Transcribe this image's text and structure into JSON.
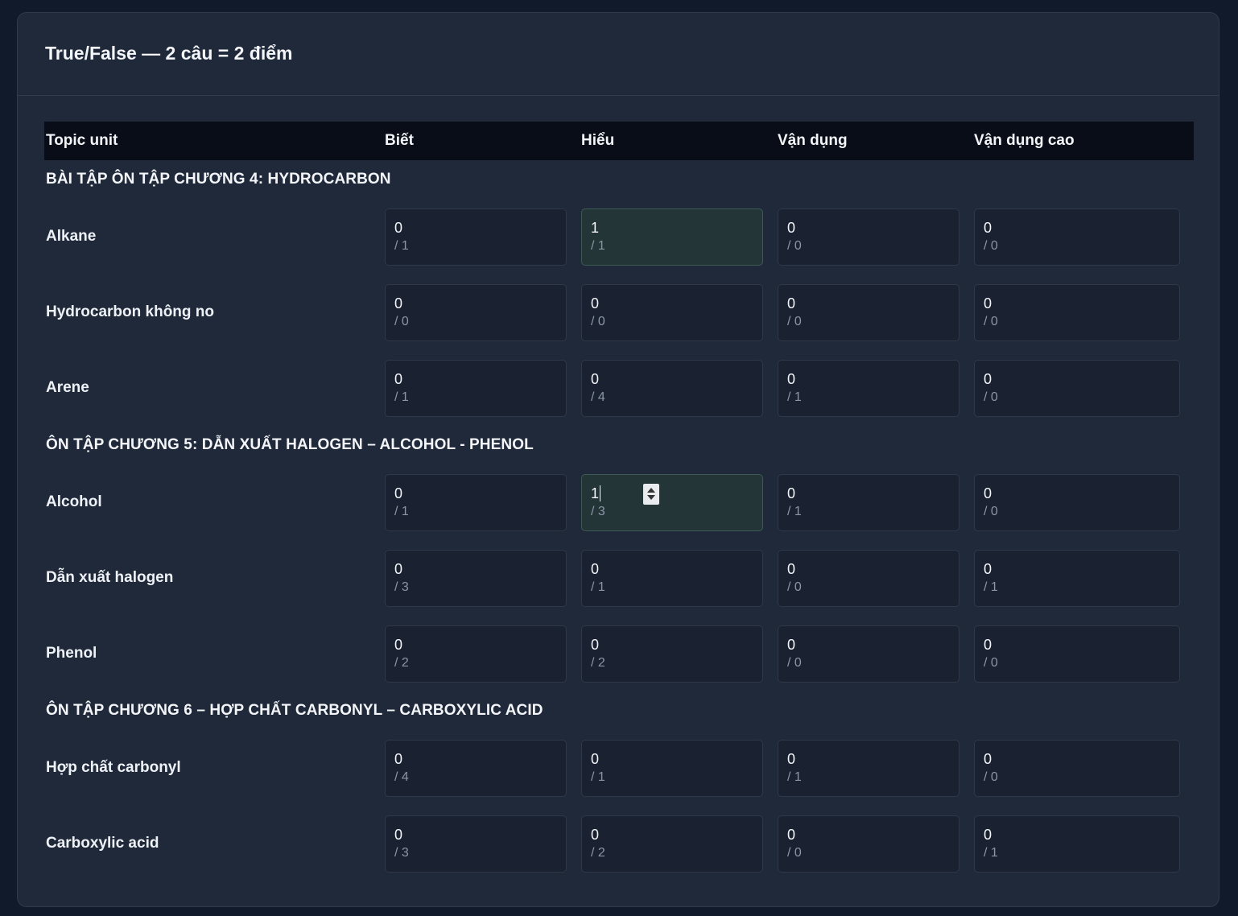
{
  "card": {
    "title": "True/False — 2 câu = 2 điểm"
  },
  "table": {
    "headers": [
      "Topic unit",
      "Biết",
      "Hiểu",
      "Vận dụng",
      "Vận dụng cao"
    ],
    "sections": [
      {
        "title": "BÀI TẬP ÔN TẬP CHƯƠNG 4: HYDROCARBON",
        "rows": [
          {
            "label": "Alkane",
            "cells": [
              {
                "value": "0",
                "max": "/ 1"
              },
              {
                "value": "1",
                "max": "/ 1",
                "active": true
              },
              {
                "value": "0",
                "max": "/ 0"
              },
              {
                "value": "0",
                "max": "/ 0"
              }
            ]
          },
          {
            "label": "Hydrocarbon không no",
            "cells": [
              {
                "value": "0",
                "max": "/ 0"
              },
              {
                "value": "0",
                "max": "/ 0"
              },
              {
                "value": "0",
                "max": "/ 0"
              },
              {
                "value": "0",
                "max": "/ 0"
              }
            ]
          },
          {
            "label": "Arene",
            "cells": [
              {
                "value": "0",
                "max": "/ 1"
              },
              {
                "value": "0",
                "max": "/ 4"
              },
              {
                "value": "0",
                "max": "/ 1"
              },
              {
                "value": "0",
                "max": "/ 0"
              }
            ]
          }
        ]
      },
      {
        "title": "ÔN TẬP CHƯƠNG 5: DẪN XUẤT HALOGEN – ALCOHOL - PHENOL",
        "rows": [
          {
            "label": "Alcohol",
            "cells": [
              {
                "value": "0",
                "max": "/ 1"
              },
              {
                "value": "1",
                "max": "/ 3",
                "active": true,
                "focused": true
              },
              {
                "value": "0",
                "max": "/ 1"
              },
              {
                "value": "0",
                "max": "/ 0"
              }
            ]
          },
          {
            "label": "Dẫn xuất halogen",
            "cells": [
              {
                "value": "0",
                "max": "/ 3"
              },
              {
                "value": "0",
                "max": "/ 1"
              },
              {
                "value": "0",
                "max": "/ 0"
              },
              {
                "value": "0",
                "max": "/ 1"
              }
            ]
          },
          {
            "label": "Phenol",
            "cells": [
              {
                "value": "0",
                "max": "/ 2"
              },
              {
                "value": "0",
                "max": "/ 2"
              },
              {
                "value": "0",
                "max": "/ 0"
              },
              {
                "value": "0",
                "max": "/ 0"
              }
            ]
          }
        ]
      },
      {
        "title": "ÔN TẬP CHƯƠNG 6 – HỢP CHẤT CARBONYL – CARBOXYLIC ACID",
        "rows": [
          {
            "label": "Hợp chất carbonyl",
            "cells": [
              {
                "value": "0",
                "max": "/ 4"
              },
              {
                "value": "0",
                "max": "/ 1"
              },
              {
                "value": "0",
                "max": "/ 1"
              },
              {
                "value": "0",
                "max": "/ 0"
              }
            ]
          },
          {
            "label": "Carboxylic acid",
            "cells": [
              {
                "value": "0",
                "max": "/ 3"
              },
              {
                "value": "0",
                "max": "/ 2"
              },
              {
                "value": "0",
                "max": "/ 0"
              },
              {
                "value": "0",
                "max": "/ 1"
              }
            ]
          }
        ]
      }
    ]
  }
}
